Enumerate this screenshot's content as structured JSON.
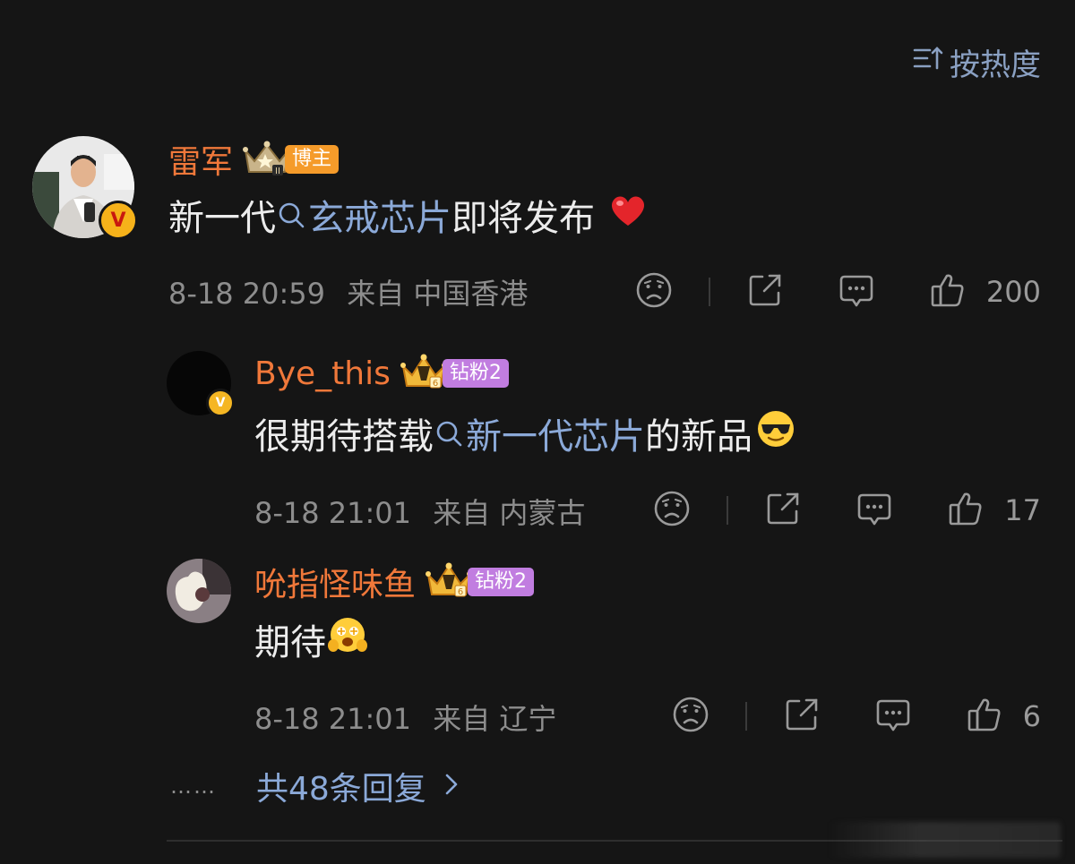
{
  "sort": {
    "label": "按热度",
    "icon": "sort-icon"
  },
  "comments": [
    {
      "username": "雷军",
      "badge": "博主",
      "content_prefix": "新一代",
      "topic": "玄戒芯片",
      "content_suffix": " 即将发布",
      "emoji": "heart",
      "time": "8-18 20:59",
      "location": "来自 中国香港",
      "likes": "200"
    },
    {
      "username": "Bye_this",
      "badge": "钻粉2",
      "content_prefix": "很期待搭载",
      "topic": "新一代芯片",
      "content_suffix": " 的新品",
      "emoji": "cool-face",
      "time": "8-18 21:01",
      "location": "来自 内蒙古",
      "likes": "17"
    },
    {
      "username": "吮指怪味鱼",
      "badge": "钻粉2",
      "content_prefix": "期待",
      "topic": "",
      "content_suffix": "",
      "emoji": "excited-face",
      "time": "8-18 21:01",
      "location": "来自 辽宁",
      "likes": "6"
    }
  ],
  "more": {
    "dots": "……",
    "label": "共48条回复"
  },
  "colors": {
    "background": "#151515",
    "username": "#f0783a",
    "link": "#8ba9d8",
    "meta": "#8d8d8d",
    "tag_bozhu": "#f59b2a",
    "tag_zuanfen": "#c17de0"
  }
}
